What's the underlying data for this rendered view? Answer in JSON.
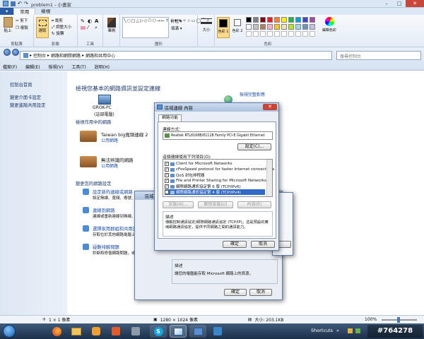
{
  "paint": {
    "title": "problem1 - 小畫家",
    "tabs": [
      "",
      "常用",
      "檢視"
    ],
    "groups": {
      "clipboard": "剪貼簿",
      "image": "影像",
      "tools": "工具",
      "shapes": "圖形",
      "colors": "色彩"
    },
    "clip": {
      "paste": "貼上",
      "cut": "剪下",
      "copy": "複製"
    },
    "image": {
      "select": "選取",
      "crop": "裁剪",
      "resize": "調整大小",
      "rotate": "旋轉"
    },
    "brush": "筆刷",
    "outline": "外框 ▾",
    "fill": "填滿 ▾",
    "size": "大小",
    "color1": "色彩 1",
    "color2": "色彩 2",
    "edit_colors": "編輯色彩",
    "palette": [
      "#000000",
      "#7f7f7f",
      "#880015",
      "#ed1c24",
      "#ff7f27",
      "#fff200",
      "#22b14c",
      "#00a2e8",
      "#3f48cc",
      "#a349a4",
      "#ffffff",
      "#c3c3c3",
      "#b97a57",
      "#ffaec9",
      "#ffc90e",
      "#efe4b0",
      "#b5e61d",
      "#99d9ea",
      "#7092be",
      "#c8bfe7"
    ]
  },
  "explorer": {
    "breadcrumb": [
      "控制台",
      "網路和網際網路",
      "網路和共用中心"
    ],
    "search_placeholder": "搜尋控制台",
    "menu": [
      "檔案(F)",
      "編輯(E)",
      "檢視(V)",
      "工具(T)",
      "說明(H)"
    ],
    "left": [
      "控制台首頁",
      "變更介面卡設定",
      "變更進階共用設定"
    ],
    "heading": "檢視您基本的網路資訊並設定連線",
    "full_map": "檢視完整對應",
    "pc_name": "GROK-PC",
    "pc_sub": "(這部電腦)",
    "active_label": "檢視作用中的網路",
    "net1_name": "Taiwan big寬頻連線 2",
    "net1_type": "公用網路",
    "net2_name": "無法辨識的網路",
    "net2_type": "公用網路",
    "change_label": "變更您的網路設定",
    "tasks": [
      {
        "t": "設定新的連線或網路",
        "d": "設定無線、寬頻、撥號、臨機操作或 VPN 連線；或設定路由器或存取點。"
      },
      {
        "t": "連線到網路",
        "d": "連線或重新連線到無線、有線、撥號或 VPN 網路連線。"
      },
      {
        "t": "選擇家用群組和共用選項",
        "d": "存取位於其他網路電腦上的檔案及印表機，或變更共用設定。"
      },
      {
        "t": "疑難排解問題",
        "d": "診斷和修復網路問題，或取得疑難排解資訊。"
      }
    ]
  },
  "dlg_main": {
    "title": "區域連線 內容",
    "tab": "網路功能",
    "connect_using": "連線方式：",
    "adapter": "Realtek RTL8168B/8111B Family PCI-E Gigabit Ethernet",
    "configure": "設定(C)...",
    "items_label": "這個連線使用下列項目(O):",
    "items": [
      "Client for Microsoft Networks",
      "cFosSpeed protocol for faster Internet connections",
      "QoS 封包排程器",
      "File and Printer Sharing for Microsoft Networks",
      "網際網路通訊協定第 6 版 (TCP/IPv6)",
      "網際網路通訊協定第 4 版 (TCP/IPv4)"
    ],
    "install": "安裝(N)...",
    "uninstall": "解除安裝(U)",
    "properties": "內容(R)",
    "desc_label": "描述",
    "desc": "傳輸控制通訊協定/網際網路通訊協定 (TCP/IP)。這是預設的廣域網路通訊協定，提供不同網路之間的通訊能力。",
    "ok": "確定",
    "cancel": "取消"
  },
  "dlg_back": {
    "title": "區域連線 內容",
    "desc_label": "描述",
    "desc": "讓您的電腦能存取 Microsoft 網路上的資源。",
    "ok": "確定",
    "cancel": "取消"
  },
  "status": {
    "zoom_in": "1 × 1 像素",
    "size": "1280 × 1024 像素",
    "filesize": "大小: 203.1KB",
    "zoom": "100%"
  },
  "taskbar": {
    "shortcuts": "Shortcuts",
    "watermark": "#764278"
  }
}
